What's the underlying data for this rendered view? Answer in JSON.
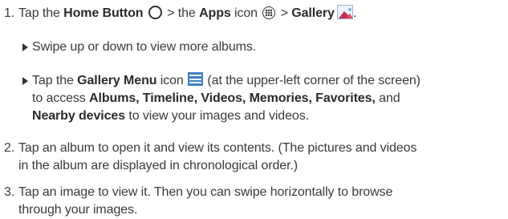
{
  "steps": [
    {
      "number": "1.",
      "parts": {
        "a": "Tap the ",
        "b": "Home Button",
        "c": " > the ",
        "d": "Apps",
        "e": " icon ",
        "f": " > ",
        "g": "Gallery",
        "h": "."
      },
      "icons": [
        "home-button-icon",
        "apps-icon",
        "gallery-icon"
      ],
      "bullets": [
        {
          "lines": [
            "Swipe up or down to view more albums."
          ]
        },
        {
          "parts": {
            "a": "Tap the ",
            "b": "Gallery Menu",
            "c": " icon ",
            "d": " (at the upper-left corner of the screen)",
            "e": "to access ",
            "f": "Albums, Timeline, Videos, Memories, Favorites,",
            "g": " and",
            "h": "Nearby devices",
            "i": " to view your images and videos."
          },
          "icons": [
            "gallery-menu-icon"
          ]
        }
      ]
    },
    {
      "number": "2.",
      "lines": [
        "Tap an album to open it and view its contents. (The pictures and videos",
        "in the album are displayed in chronological order.)"
      ]
    },
    {
      "number": "3.",
      "lines": [
        "Tap an image to view it. Then you can swipe horizontally to browse",
        "through your images."
      ]
    }
  ],
  "colors": {
    "text": "#3a3a3a",
    "menu_icon_blue": "#3f7fc1",
    "gallery_icon_pink": "#e04a6a"
  }
}
